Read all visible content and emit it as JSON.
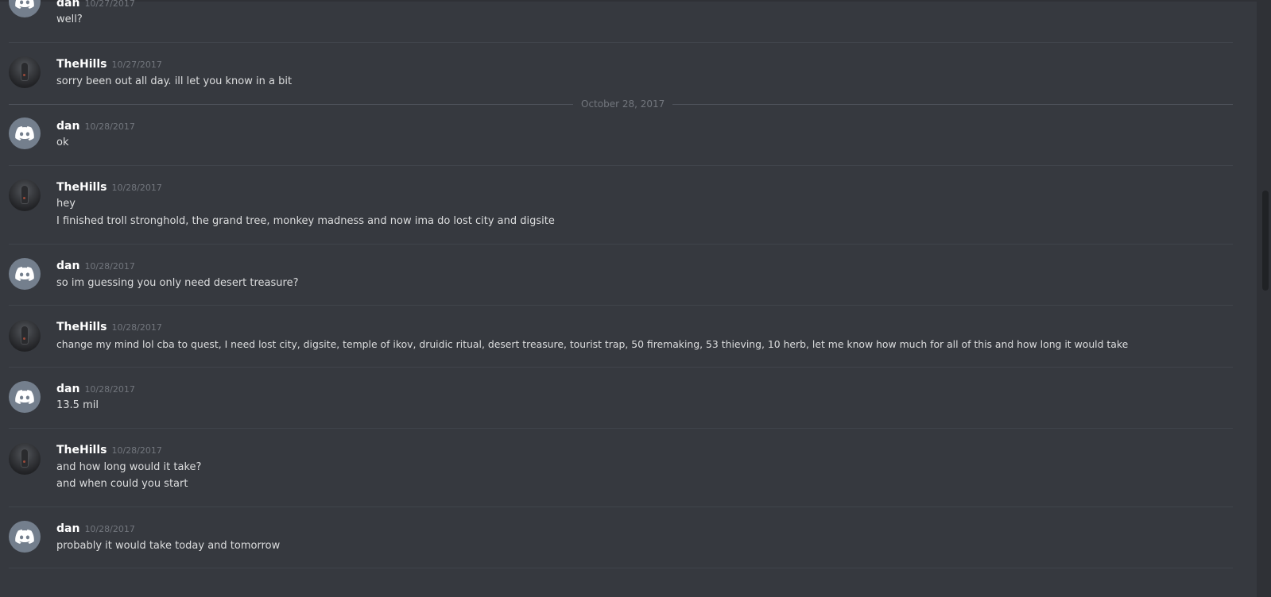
{
  "date_divider": "October 28, 2017",
  "messages": [
    {
      "author": "dan",
      "timestamp": "10/27/2017",
      "lines": [
        "well?"
      ],
      "avatar": "discord-default-avatar"
    },
    {
      "author": "TheHills",
      "timestamp": "10/27/2017",
      "lines": [
        "sorry been out all day. ill let you know in a bit"
      ],
      "avatar": "user-photo-avatar"
    },
    {
      "author": "dan",
      "timestamp": "10/28/2017",
      "lines": [
        "ok"
      ],
      "avatar": "discord-default-avatar"
    },
    {
      "author": "TheHills",
      "timestamp": "10/28/2017",
      "lines": [
        "hey",
        "I finished troll stronghold, the grand tree, monkey madness and now ima do lost city and digsite"
      ],
      "avatar": "user-photo-avatar"
    },
    {
      "author": "dan",
      "timestamp": "10/28/2017",
      "lines": [
        "so im guessing you only need desert treasure?"
      ],
      "avatar": "discord-default-avatar"
    },
    {
      "author": "TheHills",
      "timestamp": "10/28/2017",
      "lines": [
        "change my mind lol cba to quest, I need lost city, digsite, temple of ikov, druidic ritual, desert treasure, tourist trap, 50 firemaking, 53 thieving, 10 herb, let me know how much for all of this and how long it would take"
      ],
      "avatar": "user-photo-avatar"
    },
    {
      "author": "dan",
      "timestamp": "10/28/2017",
      "lines": [
        "13.5 mil"
      ],
      "avatar": "discord-default-avatar"
    },
    {
      "author": "TheHills",
      "timestamp": "10/28/2017",
      "lines": [
        "and how long would it take?",
        "and when could you start"
      ],
      "avatar": "user-photo-avatar"
    },
    {
      "author": "dan",
      "timestamp": "10/28/2017",
      "lines": [
        "probably it would take today and tomorrow"
      ],
      "avatar": "discord-default-avatar"
    }
  ],
  "colors": {
    "background": "#36393f",
    "author": "#ffffff",
    "timestamp": "#72767d",
    "text": "#dcddde",
    "separator": "#40444b",
    "discord_avatar": "#747f8d"
  }
}
